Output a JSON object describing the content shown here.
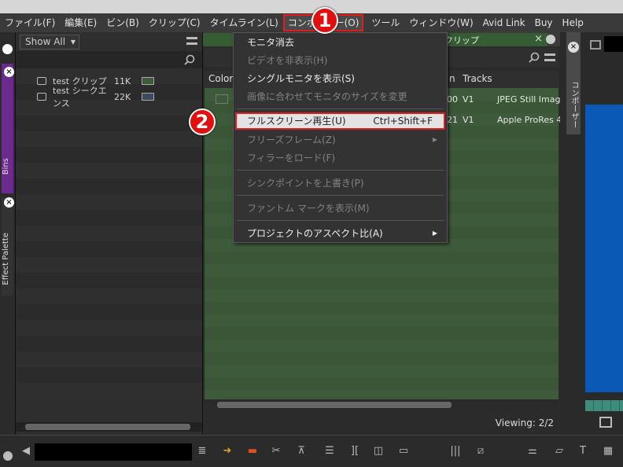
{
  "menubar": {
    "items": [
      "ファイル(F)",
      "編集(E)",
      "ビン(B)",
      "クリップ(C)",
      "タイムライン(L)",
      "コンポーザー(O)",
      "ツール",
      "ウィンドウ(W)",
      "Avid Link",
      "Buy",
      "Help"
    ]
  },
  "badges": {
    "one": "1",
    "two": "2"
  },
  "left_tabs": {
    "bins": "Bins",
    "effect_palette": "Effect Palette"
  },
  "bin_panel": {
    "show_all": "Show All",
    "items": [
      {
        "name": "test クリップ",
        "size": "11K",
        "color": "#3f5a3b"
      },
      {
        "name": "test シークエンス",
        "size": "22K",
        "color": "#3c4a5e"
      }
    ]
  },
  "bin_window": {
    "tab_title": "クリップ",
    "columns": {
      "color": "Color",
      "col_n": "n",
      "tracks": "Tracks"
    },
    "rows": [
      {
        "dur": "00",
        "tracks": "V1",
        "format": "JPEG Still Imag"
      },
      {
        "dur": "21",
        "tracks": "V1",
        "format": "Apple ProRes 4"
      }
    ],
    "viewing": "Viewing: 2/2"
  },
  "dropdown": {
    "items": [
      {
        "label": "モニタ消去",
        "enabled": true
      },
      {
        "label": "ビデオを非表示(H)",
        "enabled": false
      },
      {
        "label": "シングルモニタを表示(S)",
        "enabled": true
      },
      {
        "label": "画像に合わせてモニタのサイズを変更",
        "enabled": false
      },
      {
        "label": "フルスクリーン再生(U)",
        "shortcut": "Ctrl+Shift+F",
        "enabled": true,
        "highlighted": true
      },
      {
        "label": "フリーズフレーム(Z)",
        "enabled": false,
        "submenu": true
      },
      {
        "label": "フィラーをロード(F)",
        "enabled": false
      },
      {
        "label": "シンクポイントを上書き(P)",
        "enabled": false
      },
      {
        "label": "ファントム マークを表示(M)",
        "enabled": false
      },
      {
        "label": "プロジェクトのアスペクト比(A)",
        "enabled": true,
        "submenu": true
      }
    ]
  },
  "right_panel": {
    "composer_tab": "コンポーザー"
  },
  "colors": {
    "highlight_border": "#e11e1e",
    "bin_green": "#3d5a3a",
    "composer_blue": "#0a5ab5",
    "bins_tab_purple": "#6a2b8c"
  }
}
